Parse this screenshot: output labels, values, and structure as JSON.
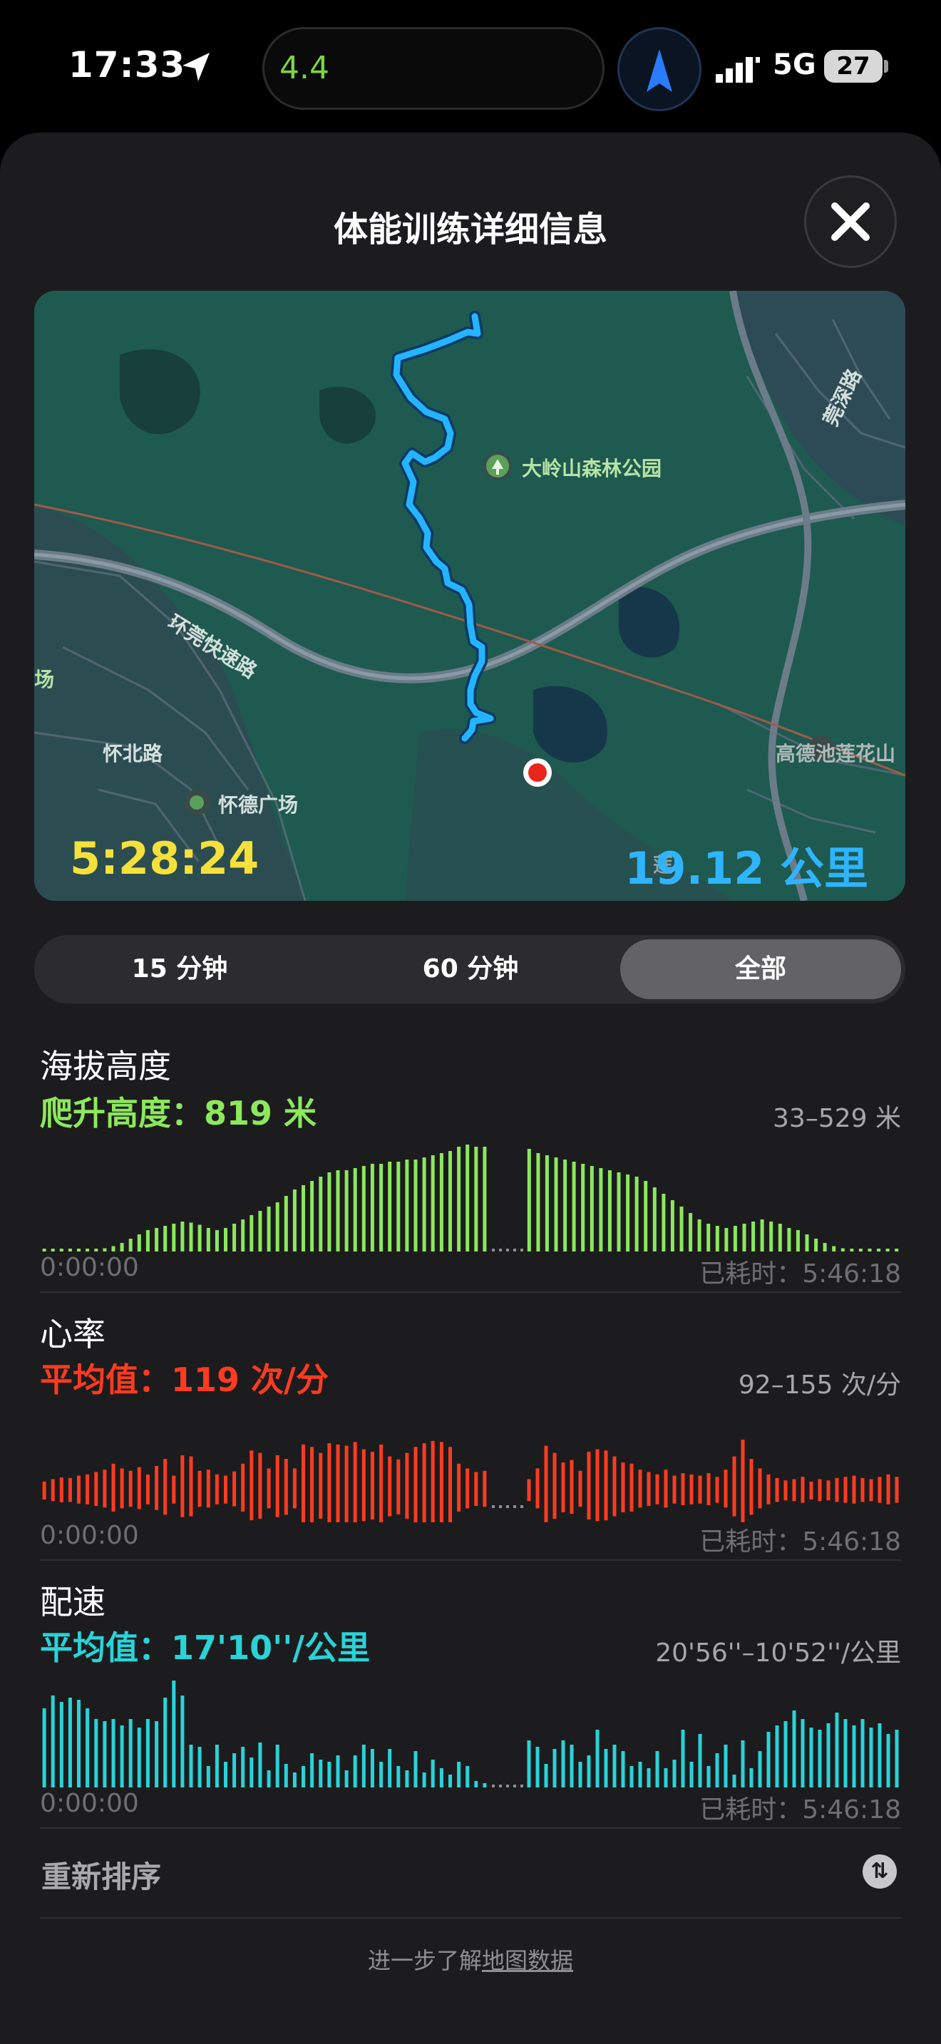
{
  "status": {
    "time": "17:33",
    "island_value": "4.4",
    "network": "5G",
    "battery": "27"
  },
  "sheet": {
    "title": "体能训练详细信息"
  },
  "map": {
    "labels": {
      "park": "大岭山森林公园",
      "expressway": "环莞快速路",
      "road_north": "怀北路",
      "plaza": "怀德广场",
      "east_area": "高德池莲花山",
      "road_east": "莞深路",
      "west_fragment": "场",
      "south_fragment": "莲"
    },
    "duration": "5:28:24",
    "distance": "19.12 公里"
  },
  "segments": {
    "items": [
      "15 分钟",
      "60 分钟",
      "全部"
    ],
    "selected_index": 2
  },
  "metrics": [
    {
      "title": "海拔高度",
      "subtitle": "爬升高度：819 米",
      "range": "33–529 米",
      "start": "0:00:00",
      "end": "已耗时：5:46:18",
      "color": "#8ce85c",
      "style": "bottom",
      "left_values": [
        2,
        2,
        2,
        2,
        2,
        2,
        2,
        3,
        5,
        8,
        12,
        16,
        20,
        22,
        24,
        26,
        28,
        27,
        25,
        22,
        20,
        22,
        26,
        30,
        34,
        38,
        42,
        46,
        52,
        58,
        62,
        66,
        70,
        74,
        76,
        76,
        78,
        80,
        82,
        82,
        84,
        84,
        86,
        86,
        88,
        90,
        92,
        94,
        98,
        100,
        98,
        98
      ],
      "right_values": [
        96,
        92,
        90,
        88,
        86,
        84,
        82,
        80,
        78,
        76,
        74,
        72,
        70,
        66,
        60,
        54,
        48,
        42,
        36,
        30,
        26,
        24,
        22,
        24,
        26,
        28,
        30,
        28,
        26,
        22,
        20,
        16,
        12,
        8,
        5,
        3,
        2,
        2,
        2,
        2,
        2,
        2
      ]
    },
    {
      "title": "心率",
      "subtitle": "平均值：119 次/分",
      "range": "92–155 次/分",
      "start": "0:00:00",
      "end": "已耗时：5:46:18",
      "color": "#ff3b1f",
      "style": "center",
      "left_values": [
        18,
        22,
        25,
        24,
        28,
        30,
        34,
        38,
        48,
        40,
        36,
        42,
        30,
        44,
        56,
        28,
        62,
        60,
        36,
        38,
        30,
        28,
        35,
        48,
        70,
        66,
        40,
        62,
        56,
        40,
        80,
        76,
        66,
        82,
        80,
        78,
        84,
        72,
        68,
        80,
        60,
        55,
        66,
        76,
        82,
        86,
        84,
        76,
        48,
        40,
        34,
        36
      ],
      "right_values": [
        22,
        40,
        78,
        66,
        50,
        54,
        36,
        68,
        72,
        70,
        60,
        50,
        48,
        38,
        34,
        30,
        38,
        28,
        32,
        30,
        28,
        32,
        26,
        38,
        60,
        88,
        56,
        40,
        30,
        24,
        20,
        22,
        26,
        18,
        22,
        20,
        24,
        26,
        28,
        24,
        22,
        26,
        30,
        26
      ]
    },
    {
      "title": "配速",
      "subtitle": "平均值：17'10''/公里",
      "range": "20'56''–10'52''/公里",
      "start": "0:00:00",
      "end": "已耗时：5:46:18",
      "color": "#29d3d8",
      "style": "bottom",
      "left_values": [
        74,
        86,
        80,
        84,
        82,
        74,
        64,
        62,
        64,
        58,
        64,
        56,
        64,
        62,
        84,
        100,
        86,
        40,
        38,
        20,
        40,
        24,
        32,
        38,
        28,
        42,
        16,
        40,
        22,
        14,
        20,
        32,
        26,
        24,
        30,
        16,
        30,
        40,
        36,
        24,
        36,
        20,
        16,
        34,
        14,
        26,
        18,
        12,
        24,
        20,
        6,
        4
      ],
      "right_values": [
        44,
        38,
        22,
        36,
        44,
        40,
        24,
        30,
        54,
        36,
        40,
        34,
        20,
        24,
        18,
        34,
        18,
        26,
        54,
        24,
        50,
        20,
        32,
        40,
        12,
        44,
        18,
        34,
        52,
        58,
        62,
        72,
        64,
        56,
        54,
        60,
        70,
        64,
        58,
        64,
        56,
        60,
        50,
        54
      ]
    }
  ],
  "reorder": {
    "label": "重新排序"
  },
  "footer": {
    "prefix": "进一步了解",
    "link": "地图数据"
  }
}
